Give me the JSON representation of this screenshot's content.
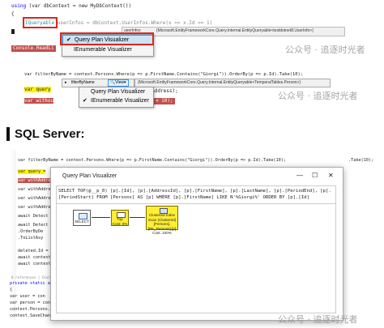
{
  "watermark": {
    "text": "公众号 · 追逐时光者"
  },
  "top_code": {
    "line1_kw": "using",
    "line1_rest": " (var dbContext = new MyDbContext())",
    "line2": "{",
    "iqueryable_type": "IQueryable",
    "line3_rest": " userInfos = dbContext.UserInfos.Where(x => x.Id == 1)",
    "line4": "}",
    "console_line": "Console.ReadLi"
  },
  "menu1": {
    "items": [
      {
        "label": "Query Plan Visualizer",
        "checked": true
      },
      {
        "label": "IEnumerable Visualizer",
        "checked": false
      }
    ],
    "tooltip_label": "userInfos",
    "tooltip_value": "{Microsoft.EntityFrameworkCore.Query.Internal.EntityQueryable<testdotnet8.UserInfo>}"
  },
  "mid_code": {
    "line1": "var filterByName = context.Persons.Where(p => p.FirstName.Contains(\"Giorgi\")).OrderBy(p => p.Id).Take(10);",
    "query_kw": "var query",
    "query_rest": "",
    "without_kw": "var withou",
    "without_rest": "sc(p => p.Id < 10);",
    "address_rest": "p.Address);"
  },
  "menu2": {
    "hover_label": "filterByName",
    "view_label": "View",
    "tooltip_value": "{Microsoft.EntityFrameworkCore.Query.Internal.EntityQueryable<TemporalTables.Person>}",
    "items": [
      {
        "label": "Query Plan Visualizer",
        "checked": false
      },
      {
        "label": "IEnumerable Visualizer",
        "checked": true
      }
    ]
  },
  "heading": "SQL Server:",
  "bottom_code": {
    "lines": [
      "var filterByName = context.Persons.Where(p => p.FirstName.Contains(\"Giorgi\")).OrderBy(p => p.Id).Take(10);",
      "var query = ",
      "var withAddre",
      "var withAddre",
      "var withAddre",
      "var withAddre",
      "await Detect",
      "await Detect",
      "  .OrderByDe",
      "  .ToListAsy",
      "deleted.Id = 0",
      "await context",
      "await context.Sa",
      "0 references | Giorgi, 171 days a",
      "private static async",
      "{",
      "  var user = con",
      "  var person = context",
      "  context.Persons.Re",
      "  context.SaveChangesAsync();"
    ],
    "fragment_top": ".Take(10);",
    "fragment_bottom_1": "10);"
  },
  "dialog": {
    "title": "Query Plan Visualizer",
    "sql_lines": [
      "SELECT TOP(@__p_0) [p].[Id], [p].[AddressId], [p].[FirstName], [p].[LastName], [p].[PeriodEnd], [p].",
      "[PeriodStart] FROM [Persons] AS [p] WHERE [p].[FirstName] LIKE N'%Giorgi%' ORDER BY [p].[Id]"
    ],
    "nodes": [
      {
        "label": "SELECT",
        "cost": ""
      },
      {
        "label": "Top",
        "cost": "Cost: 0%"
      },
      {
        "label": "Clustered Index Scan (Clustered)",
        "detail": "[Persons].[PK_Persons].[p]",
        "cost": "Cost: 100%"
      }
    ],
    "controls": {
      "minimize": "—",
      "maximize": "☐",
      "close": "✕"
    }
  },
  "colors": {
    "highlight_red": "#c0504d",
    "highlight_yellow": "#fff200",
    "redbox": "#e0261b",
    "node_yellow": "#ffee33"
  }
}
